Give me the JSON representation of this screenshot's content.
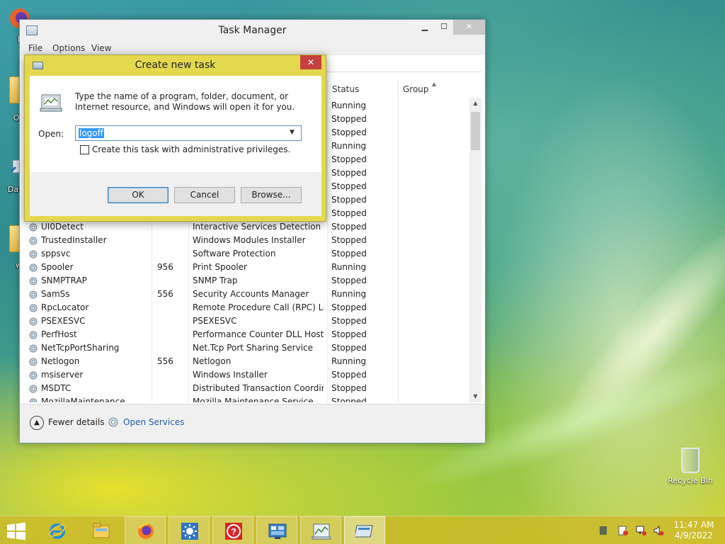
{
  "desktop": {
    "icons": [
      {
        "label": "F"
      },
      {
        "label": "Old"
      },
      {
        "label": "Data"
      },
      {
        "label": "wi"
      }
    ],
    "recycle_bin": "Recycle Bin"
  },
  "task_manager": {
    "title": "Task Manager",
    "menu": [
      "File",
      "Options",
      "View"
    ],
    "columns": {
      "status": "Status",
      "group": "Group"
    },
    "status_only_rows": [
      "Running",
      "Stopped",
      "Stopped",
      "Running",
      "Stopped",
      "Stopped",
      "Stopped",
      "Stopped",
      "Stopped"
    ],
    "services": [
      {
        "name": "UI0Detect",
        "pid": "",
        "description": "Interactive Services Detection",
        "status": "Stopped"
      },
      {
        "name": "TrustedInstaller",
        "pid": "",
        "description": "Windows Modules Installer",
        "status": "Stopped"
      },
      {
        "name": "sppsvc",
        "pid": "",
        "description": "Software Protection",
        "status": "Stopped"
      },
      {
        "name": "Spooler",
        "pid": "956",
        "description": "Print Spooler",
        "status": "Running"
      },
      {
        "name": "SNMPTRAP",
        "pid": "",
        "description": "SNMP Trap",
        "status": "Stopped"
      },
      {
        "name": "SamSs",
        "pid": "556",
        "description": "Security Accounts Manager",
        "status": "Running"
      },
      {
        "name": "RpcLocator",
        "pid": "",
        "description": "Remote Procedure Call (RPC) Lo...",
        "status": "Stopped"
      },
      {
        "name": "PSEXESVC",
        "pid": "",
        "description": "PSEXESVC",
        "status": "Stopped"
      },
      {
        "name": "PerfHost",
        "pid": "",
        "description": "Performance Counter DLL Host",
        "status": "Stopped"
      },
      {
        "name": "NetTcpPortSharing",
        "pid": "",
        "description": "Net.Tcp Port Sharing Service",
        "status": "Stopped"
      },
      {
        "name": "Netlogon",
        "pid": "556",
        "description": "Netlogon",
        "status": "Running"
      },
      {
        "name": "msiserver",
        "pid": "",
        "description": "Windows Installer",
        "status": "Stopped"
      },
      {
        "name": "MSDTC",
        "pid": "",
        "description": "Distributed Transaction Coordin...",
        "status": "Stopped"
      },
      {
        "name": "MozillaMaintenance",
        "pid": "",
        "description": "Mozilla Maintenance Service",
        "status": "Stopped"
      }
    ],
    "footer": {
      "fewer_details": "Fewer details",
      "open_services": "Open Services"
    }
  },
  "dialog": {
    "title": "Create new task",
    "description": "Type the name of a program, folder, document, or Internet resource, and Windows will open it for you.",
    "open_label": "Open:",
    "open_value": "logoff",
    "admin_checkbox_label": "Create this task with administrative privileges.",
    "admin_checked": false,
    "buttons": {
      "ok": "OK",
      "cancel": "Cancel",
      "browse": "Browse..."
    },
    "close_glyph": "✕"
  },
  "taskbar": {
    "clock_time": "11:47 AM",
    "clock_date": "4/9/2022",
    "items": [
      "windows-logo-icon",
      "internet-explorer-icon",
      "file-explorer-icon",
      "firefox-icon",
      "sun-settings-icon",
      "help-icon",
      "control-panel-icon",
      "task-manager-icon",
      "run-dialog-icon"
    ]
  }
}
